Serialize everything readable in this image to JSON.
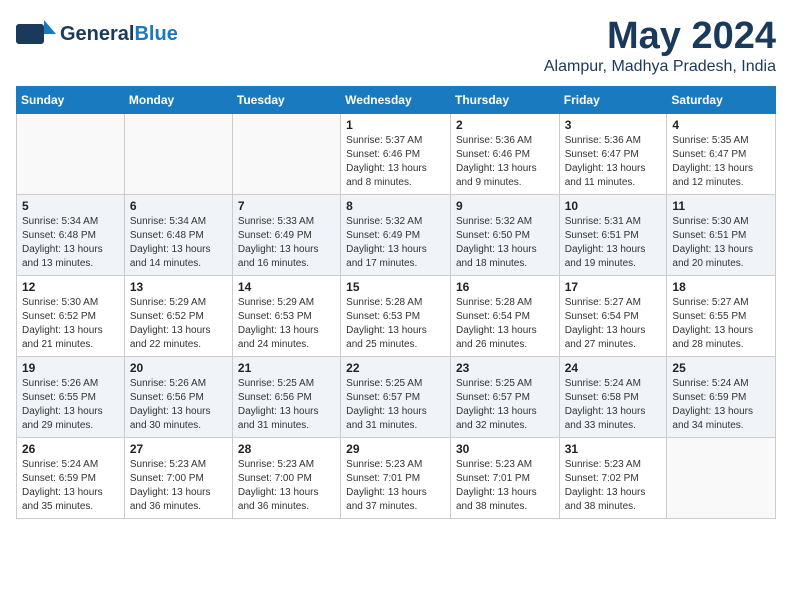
{
  "header": {
    "logo_general": "General",
    "logo_blue": "Blue",
    "month": "May 2024",
    "location": "Alampur, Madhya Pradesh, India"
  },
  "weekdays": [
    "Sunday",
    "Monday",
    "Tuesday",
    "Wednesday",
    "Thursday",
    "Friday",
    "Saturday"
  ],
  "weeks": [
    [
      {
        "day": "",
        "info": ""
      },
      {
        "day": "",
        "info": ""
      },
      {
        "day": "",
        "info": ""
      },
      {
        "day": "1",
        "info": "Sunrise: 5:37 AM\nSunset: 6:46 PM\nDaylight: 13 hours\nand 8 minutes."
      },
      {
        "day": "2",
        "info": "Sunrise: 5:36 AM\nSunset: 6:46 PM\nDaylight: 13 hours\nand 9 minutes."
      },
      {
        "day": "3",
        "info": "Sunrise: 5:36 AM\nSunset: 6:47 PM\nDaylight: 13 hours\nand 11 minutes."
      },
      {
        "day": "4",
        "info": "Sunrise: 5:35 AM\nSunset: 6:47 PM\nDaylight: 13 hours\nand 12 minutes."
      }
    ],
    [
      {
        "day": "5",
        "info": "Sunrise: 5:34 AM\nSunset: 6:48 PM\nDaylight: 13 hours\nand 13 minutes."
      },
      {
        "day": "6",
        "info": "Sunrise: 5:34 AM\nSunset: 6:48 PM\nDaylight: 13 hours\nand 14 minutes."
      },
      {
        "day": "7",
        "info": "Sunrise: 5:33 AM\nSunset: 6:49 PM\nDaylight: 13 hours\nand 16 minutes."
      },
      {
        "day": "8",
        "info": "Sunrise: 5:32 AM\nSunset: 6:49 PM\nDaylight: 13 hours\nand 17 minutes."
      },
      {
        "day": "9",
        "info": "Sunrise: 5:32 AM\nSunset: 6:50 PM\nDaylight: 13 hours\nand 18 minutes."
      },
      {
        "day": "10",
        "info": "Sunrise: 5:31 AM\nSunset: 6:51 PM\nDaylight: 13 hours\nand 19 minutes."
      },
      {
        "day": "11",
        "info": "Sunrise: 5:30 AM\nSunset: 6:51 PM\nDaylight: 13 hours\nand 20 minutes."
      }
    ],
    [
      {
        "day": "12",
        "info": "Sunrise: 5:30 AM\nSunset: 6:52 PM\nDaylight: 13 hours\nand 21 minutes."
      },
      {
        "day": "13",
        "info": "Sunrise: 5:29 AM\nSunset: 6:52 PM\nDaylight: 13 hours\nand 22 minutes."
      },
      {
        "day": "14",
        "info": "Sunrise: 5:29 AM\nSunset: 6:53 PM\nDaylight: 13 hours\nand 24 minutes."
      },
      {
        "day": "15",
        "info": "Sunrise: 5:28 AM\nSunset: 6:53 PM\nDaylight: 13 hours\nand 25 minutes."
      },
      {
        "day": "16",
        "info": "Sunrise: 5:28 AM\nSunset: 6:54 PM\nDaylight: 13 hours\nand 26 minutes."
      },
      {
        "day": "17",
        "info": "Sunrise: 5:27 AM\nSunset: 6:54 PM\nDaylight: 13 hours\nand 27 minutes."
      },
      {
        "day": "18",
        "info": "Sunrise: 5:27 AM\nSunset: 6:55 PM\nDaylight: 13 hours\nand 28 minutes."
      }
    ],
    [
      {
        "day": "19",
        "info": "Sunrise: 5:26 AM\nSunset: 6:55 PM\nDaylight: 13 hours\nand 29 minutes."
      },
      {
        "day": "20",
        "info": "Sunrise: 5:26 AM\nSunset: 6:56 PM\nDaylight: 13 hours\nand 30 minutes."
      },
      {
        "day": "21",
        "info": "Sunrise: 5:25 AM\nSunset: 6:56 PM\nDaylight: 13 hours\nand 31 minutes."
      },
      {
        "day": "22",
        "info": "Sunrise: 5:25 AM\nSunset: 6:57 PM\nDaylight: 13 hours\nand 31 minutes."
      },
      {
        "day": "23",
        "info": "Sunrise: 5:25 AM\nSunset: 6:57 PM\nDaylight: 13 hours\nand 32 minutes."
      },
      {
        "day": "24",
        "info": "Sunrise: 5:24 AM\nSunset: 6:58 PM\nDaylight: 13 hours\nand 33 minutes."
      },
      {
        "day": "25",
        "info": "Sunrise: 5:24 AM\nSunset: 6:59 PM\nDaylight: 13 hours\nand 34 minutes."
      }
    ],
    [
      {
        "day": "26",
        "info": "Sunrise: 5:24 AM\nSunset: 6:59 PM\nDaylight: 13 hours\nand 35 minutes."
      },
      {
        "day": "27",
        "info": "Sunrise: 5:23 AM\nSunset: 7:00 PM\nDaylight: 13 hours\nand 36 minutes."
      },
      {
        "day": "28",
        "info": "Sunrise: 5:23 AM\nSunset: 7:00 PM\nDaylight: 13 hours\nand 36 minutes."
      },
      {
        "day": "29",
        "info": "Sunrise: 5:23 AM\nSunset: 7:01 PM\nDaylight: 13 hours\nand 37 minutes."
      },
      {
        "day": "30",
        "info": "Sunrise: 5:23 AM\nSunset: 7:01 PM\nDaylight: 13 hours\nand 38 minutes."
      },
      {
        "day": "31",
        "info": "Sunrise: 5:23 AM\nSunset: 7:02 PM\nDaylight: 13 hours\nand 38 minutes."
      },
      {
        "day": "",
        "info": ""
      }
    ]
  ]
}
